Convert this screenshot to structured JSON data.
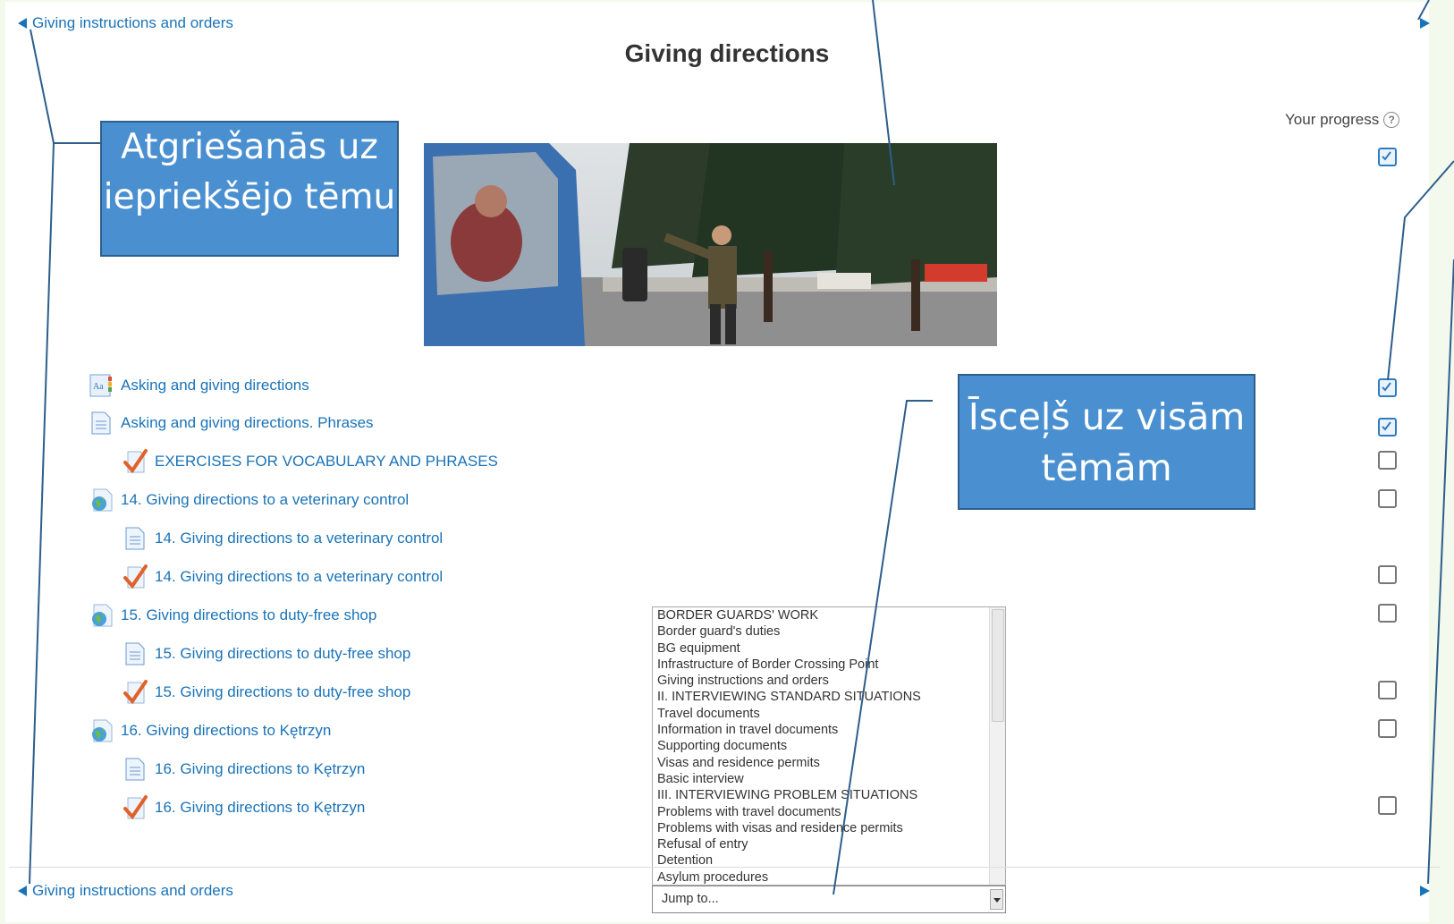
{
  "nav": {
    "prev_top": "Giving instructions and orders",
    "prev_bottom": "Giving instructions and orders"
  },
  "page_title": "Giving directions",
  "progress": {
    "label": "Your progress",
    "help": "?"
  },
  "callouts": {
    "back": "Atgriešanās uz iepriekšējo tēmu",
    "jump": "Īsceļš uz visām tēmām"
  },
  "activities": [
    {
      "label": "Asking and giving directions",
      "icon": "glossary-icon",
      "done": true
    },
    {
      "label": "Asking and giving directions. Phrases",
      "icon": "page-icon",
      "done": true
    },
    {
      "label": "EXERCISES FOR VOCABULARY AND PHRASES",
      "icon": "quiz-icon",
      "done": false
    },
    {
      "label": "14. Giving directions to a veterinary control",
      "icon": "url-icon",
      "done": false
    },
    {
      "label": "14. Giving directions to a veterinary control",
      "icon": "page-icon",
      "done": null
    },
    {
      "label": "14. Giving directions to a veterinary control",
      "icon": "quiz-icon",
      "done": false
    },
    {
      "label": "15. Giving directions to duty-free shop",
      "icon": "url-icon",
      "done": false
    },
    {
      "label": "15. Giving directions to duty-free shop",
      "icon": "page-icon",
      "done": null
    },
    {
      "label": "15. Giving directions to duty-free shop",
      "icon": "quiz-icon",
      "done": false
    },
    {
      "label": "16. Giving directions to Kętrzyn",
      "icon": "url-icon",
      "done": false
    },
    {
      "label": "16. Giving directions to Kętrzyn",
      "icon": "page-icon",
      "done": null
    },
    {
      "label": "16. Giving directions to Kętrzyn",
      "icon": "quiz-icon",
      "done": false
    }
  ],
  "jump_menu": {
    "placeholder": "Jump to...",
    "options": [
      "BORDER GUARDS' WORK",
      "Border guard's duties",
      "BG equipment",
      "Infrastructure of Border Crossing Point",
      "Giving instructions and orders",
      "II. INTERVIEWING STANDARD SITUATIONS",
      "Travel documents",
      "Information in travel documents",
      "Supporting documents",
      "Visas and residence permits",
      "Basic interview",
      "III. INTERVIEWING PROBLEM SITUATIONS",
      "Problems with travel documents",
      "Problems with visas and residence permits",
      "Refusal of entry",
      "Detention",
      "Asylum procedures"
    ]
  },
  "colors": {
    "link": "#1a73b8",
    "callout": "#4a90d0",
    "annotation_line": "#2d5e8c"
  }
}
